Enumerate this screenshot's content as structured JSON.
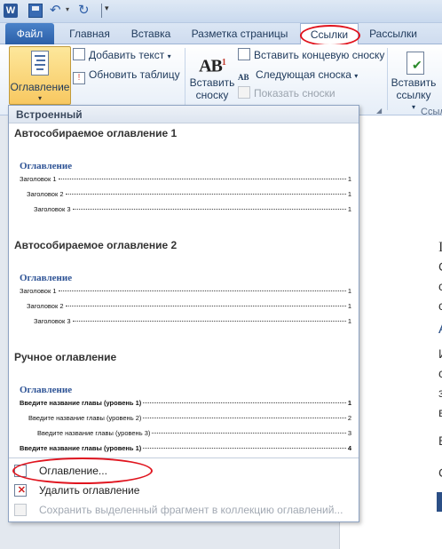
{
  "app": {
    "logo_letter": "W"
  },
  "tabs": [
    {
      "label": "Файл"
    },
    {
      "label": "Главная"
    },
    {
      "label": "Вставка"
    },
    {
      "label": "Разметка страницы"
    },
    {
      "label": "Ссылки"
    },
    {
      "label": "Рассылки"
    }
  ],
  "ribbon": {
    "toc_button": "Оглавление",
    "add_text": "Добавить текст",
    "update_table": "Обновить таблицу",
    "insert_footnote_line1": "Вставить",
    "insert_footnote_line2": "сноску",
    "insert_endnote": "Вставить концевую сноску",
    "next_footnote": "Следующая сноска",
    "show_notes": "Показать сноски",
    "insert_citation_line1": "Вставить",
    "insert_citation_line2": "ссылку",
    "group_label_partial": "Ссыл",
    "footnote_icon_text": "AB",
    "footnote_icon_sup": "1",
    "endnote_icon_text": "AB"
  },
  "gallery": {
    "header": "Встроенный",
    "items": [
      {
        "title": "Автособираемое оглавление 1",
        "heading": "Оглавление",
        "lines": [
          {
            "text": "Заголовок 1",
            "num": "1"
          },
          {
            "text": "Заголовок 2",
            "num": "1"
          },
          {
            "text": "Заголовок 3",
            "num": "1"
          }
        ]
      },
      {
        "title": "Автособираемое оглавление 2",
        "heading": "Оглавление",
        "lines": [
          {
            "text": "Заголовок 1",
            "num": "1"
          },
          {
            "text": "Заголовок 2",
            "num": "1"
          },
          {
            "text": "Заголовок 3",
            "num": "1"
          }
        ]
      },
      {
        "title": "Ручное оглавление",
        "heading": "Оглавление",
        "lines": [
          {
            "text": "Введите название главы (уровень 1)",
            "num": "1"
          },
          {
            "text": "Введите название главы (уровень 2)",
            "num": "2"
          },
          {
            "text": "Введите название главы (уровень 3)",
            "num": "3"
          },
          {
            "text": "Введите название главы (уровень 1)",
            "num": "4"
          }
        ]
      }
    ],
    "footer": {
      "toc_dialog": "Оглавление...",
      "remove_toc": "Удалить оглавление",
      "save_selection": "Сохранить выделенный фрагмент в коллекцию оглавлений..."
    }
  },
  "document": {
    "chars": [
      "I",
      "C",
      "c",
      "c",
      "A",
      "И",
      "c",
      "з",
      "в",
      "В",
      "С"
    ]
  },
  "colors": {
    "accent": "#2b579a",
    "highlight_ellipse": "#e0141e",
    "toc_heading": "#2f5496",
    "toc_button_bg": "#f8c861"
  }
}
